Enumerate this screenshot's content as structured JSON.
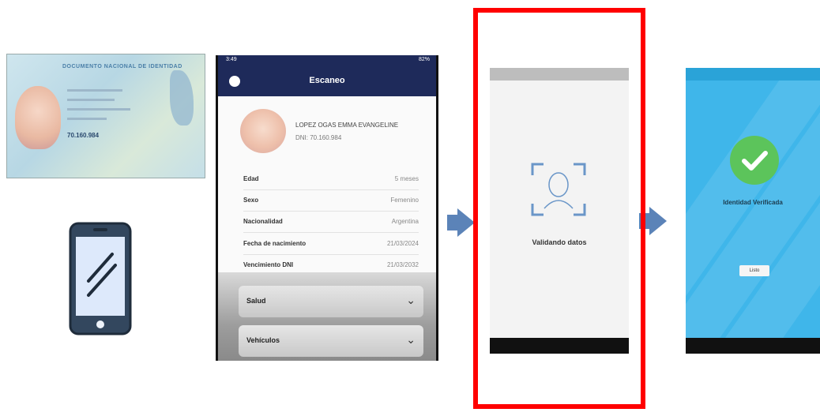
{
  "id_card": {
    "header": "DOCUMENTO NACIONAL DE IDENTIDAD",
    "number": "70.160.984"
  },
  "scan_screen": {
    "status_time": "3:49",
    "status_battery": "82%",
    "title": "Escaneo",
    "name": "LOPEZ OGAS EMMA EVANGELINE",
    "dni": "DNI: 70.160.984",
    "rows": [
      {
        "key": "Edad",
        "value": "5 meses"
      },
      {
        "key": "Sexo",
        "value": "Femenino"
      },
      {
        "key": "Nacionalidad",
        "value": "Argentina"
      },
      {
        "key": "Fecha de nacimiento",
        "value": "21/03/2024"
      },
      {
        "key": "Vencimiento DNI",
        "value": "21/03/2032"
      }
    ],
    "accordions": [
      {
        "label": "Salud"
      },
      {
        "label": "Vehículos"
      }
    ]
  },
  "validating_screen": {
    "label": "Validando datos"
  },
  "verified_screen": {
    "label": "Identidad Verificada",
    "button": "Listo"
  },
  "colors": {
    "highlight": "#ff0000",
    "arrow": "#5b83b8",
    "app_header": "#1e2a5a",
    "verified_bg": "#3fb6ea",
    "check": "#5cc45b"
  }
}
